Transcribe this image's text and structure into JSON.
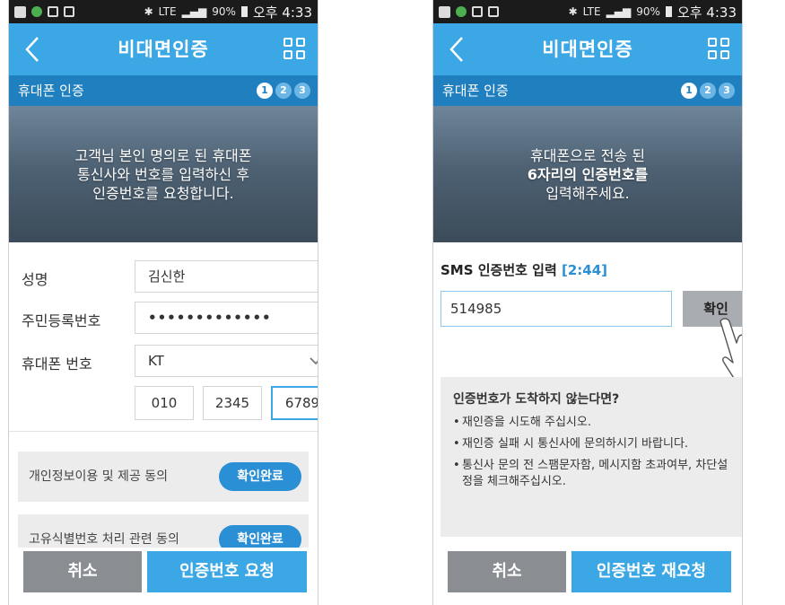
{
  "status_bar": {
    "signal_text": "LTE",
    "battery": "90%",
    "time": "오후 4:33"
  },
  "screens": [
    {
      "app_title": "비대면인증",
      "step_title": "휴대폰 인증",
      "steps": [
        "1",
        "2",
        "3"
      ],
      "active_step": 1,
      "hero_lines": [
        "고객님 본인 명의로 된 휴대폰",
        "통신사와 번호를 입력하신 후",
        "인증번호를 요청합니다."
      ],
      "form": {
        "name_label": "성명",
        "name_value": "김신한",
        "rrn_label": "주민등록번호",
        "rrn_value": "•••••••••••••",
        "phone_label": "휴대폰 번호",
        "carrier_value": "KT",
        "phone_parts": [
          "010",
          "2345",
          "6789"
        ]
      },
      "agreements": [
        {
          "label": "개인정보이용 및 제공 동의",
          "button": "확인완료"
        },
        {
          "label": "고유식별번호 처리 관련 동의",
          "button": "확인완료"
        }
      ],
      "buttons": {
        "cancel": "취소",
        "primary": "인증번호 요청"
      }
    },
    {
      "app_title": "비대면인증",
      "step_title": "휴대폰 인증",
      "steps": [
        "1",
        "2",
        "3"
      ],
      "active_step": 1,
      "hero_lines": [
        "휴대폰으로 전송 된",
        "6자리의 인증번호를",
        "입력해주세요."
      ],
      "sms": {
        "label": "SMS 인증번호 입력",
        "timer": "[2:44]",
        "code_value": "514985",
        "confirm_label": "확인"
      },
      "notice": {
        "title": "인증번호가 도착하지 않는다면?",
        "items": [
          "재인증을 시도해 주십시오.",
          "재인증 실패 시 통신사에 문의하시기 바랍니다.",
          "통신사 문의 전 스팸문자함, 메시지함 초과여부, 차단설정을 체크해주십시오."
        ]
      },
      "buttons": {
        "cancel": "취소",
        "primary": "인증번호 재요청"
      }
    }
  ],
  "colors": {
    "primary": "#3ba7e4",
    "step_bar": "#1f7fbf",
    "agree_button": "#2b8fd6",
    "cancel_button": "#8a8e92"
  }
}
